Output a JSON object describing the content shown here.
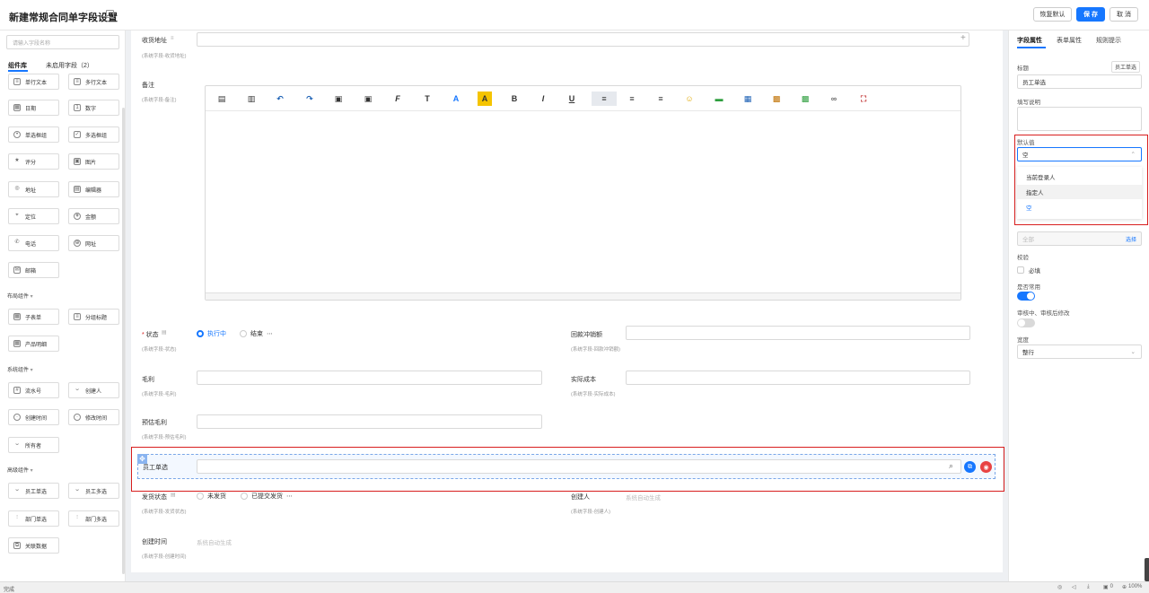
{
  "header": {
    "title": "新建常规合同单字段设置",
    "restore_label": "恢复默认",
    "save_label": "保 存",
    "cancel_label": "取 消"
  },
  "left": {
    "search_placeholder": "请输入字段名称",
    "tabs": [
      "组件库",
      "未启用字段（2）"
    ],
    "basic": [
      {
        "label": "单行文本",
        "icon": "text-icon"
      },
      {
        "label": "多行文本",
        "icon": "textarea-icon"
      },
      {
        "label": "日期",
        "icon": "calendar-icon"
      },
      {
        "label": "数字",
        "icon": "number-icon"
      },
      {
        "label": "单选框组",
        "icon": "radio-icon"
      },
      {
        "label": "多选框组",
        "icon": "checkbox-icon"
      },
      {
        "label": "评分",
        "icon": "star-icon"
      },
      {
        "label": "图片",
        "icon": "image-icon"
      },
      {
        "label": "地址",
        "icon": "location-icon"
      },
      {
        "label": "编辑器",
        "icon": "editor-icon"
      },
      {
        "label": "定位",
        "icon": "pin-icon"
      },
      {
        "label": "金额",
        "icon": "money-icon"
      },
      {
        "label": "电话",
        "icon": "phone-icon"
      },
      {
        "label": "网址",
        "icon": "globe-icon"
      },
      {
        "label": "邮箱",
        "icon": "mail-icon"
      }
    ],
    "layout_group": "布局组件",
    "layout": [
      {
        "label": "子表单",
        "icon": "subform-icon"
      },
      {
        "label": "分组标题",
        "icon": "group-title-icon"
      },
      {
        "label": "产品明细",
        "icon": "product-icon"
      }
    ],
    "system_group": "系统组件",
    "system": [
      {
        "label": "流水号",
        "icon": "serial-icon"
      },
      {
        "label": "创建人",
        "icon": "user-icon"
      },
      {
        "label": "创建时间",
        "icon": "clock-icon"
      },
      {
        "label": "修改时间",
        "icon": "edit-clock-icon"
      },
      {
        "label": "所有者",
        "icon": "owner-icon"
      }
    ],
    "advanced_group": "高级组件",
    "advanced": [
      {
        "label": "员工单选",
        "icon": "user-single-icon"
      },
      {
        "label": "员工多选",
        "icon": "users-icon"
      },
      {
        "label": "部门单选",
        "icon": "dept-icon"
      },
      {
        "label": "部门多选",
        "icon": "depts-icon"
      },
      {
        "label": "关联数据",
        "icon": "link-data-icon"
      }
    ]
  },
  "canvas": {
    "address": {
      "label": "收货地址",
      "sub": "(系统字段-收货地址)"
    },
    "remark": {
      "label": "备注",
      "sub": "(系统字段-备注)"
    },
    "status": {
      "label": "状态",
      "sub": "(系统字段-状态)",
      "opt1": "执行中",
      "opt2": "结束"
    },
    "refund": {
      "label": "回款冲销额",
      "sub": "(系统字段-回款冲销额)"
    },
    "gross": {
      "label": "毛利",
      "sub": "(系统字段-毛利)"
    },
    "actual_cost": {
      "label": "实际成本",
      "sub": "(系统字段-实际成本)"
    },
    "est_gross": {
      "label": "预估毛利",
      "sub": "(系统字段-预估毛利)"
    },
    "employee": {
      "label": "员工单选"
    },
    "ship": {
      "label": "发货状态",
      "sub": "(系统字段-发货状态)",
      "opt1": "未发货",
      "opt2": "已提交发货"
    },
    "creator": {
      "label": "创建人",
      "sub": "(系统字段-创建人)",
      "value": "系统自动生成"
    },
    "create_time": {
      "label": "创建时间",
      "sub": "(系统字段-创建时间)",
      "value": "系统自动生成"
    }
  },
  "right": {
    "tabs": [
      "字段属性",
      "表单属性",
      "规则提示"
    ],
    "title_label": "标题",
    "title_badge": "员工单选",
    "title_value": "员工单选",
    "desc_label": "填写说明",
    "default_label": "默认值",
    "default_value": "空",
    "options": [
      "当前登录人",
      "指定人",
      "空"
    ],
    "range_value": "全部",
    "range_action": "选择",
    "validate_label": "校验",
    "required_label": "必填",
    "common_label": "是否常用",
    "common_on": true,
    "audit_label": "审核中、审核后修改",
    "audit_on": false,
    "width_label": "宽度",
    "width_value": "整行",
    "accent": "#1677ff"
  },
  "status_bar": {
    "left": "完成",
    "zoom": "100%",
    "count": "0"
  }
}
